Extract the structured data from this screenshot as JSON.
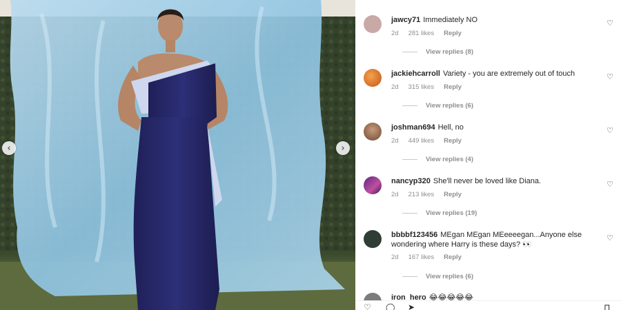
{
  "media": {
    "prev_icon": "‹",
    "next_icon": "›"
  },
  "comments": [
    {
      "username": "jawcy71",
      "text": "Immediately NO",
      "age": "2d",
      "likes": "281 likes",
      "reply": "Reply",
      "view_replies": "View replies (8)",
      "avatar_color": "#c9a9a6"
    },
    {
      "username": "jackiehcarroll",
      "text": "Variety - you are extremely out of touch",
      "age": "2d",
      "likes": "315 likes",
      "reply": "Reply",
      "view_replies": "View replies (6)",
      "avatar_color": "#d9772f"
    },
    {
      "username": "joshman694",
      "text": "Hell, no",
      "age": "2d",
      "likes": "449 likes",
      "reply": "Reply",
      "view_replies": "View replies (4)",
      "avatar_color": "#a67a5b"
    },
    {
      "username": "nancyp320",
      "text": "She'll never be loved like Diana.",
      "age": "2d",
      "likes": "213 likes",
      "reply": "Reply",
      "view_replies": "View replies (19)",
      "avatar_color": "#8a3fa0"
    },
    {
      "username": "bbbbf123456",
      "text": "MEgan MEgan MEeeeegan...Anyone else wondering where Harry is these days? 👀",
      "age": "2d",
      "likes": "167 likes",
      "reply": "Reply",
      "view_replies": "View replies (6)",
      "avatar_color": "#2f3d35"
    },
    {
      "username": "iron_hero",
      "text": "😂😂😂😂😂",
      "avatar_color": "#7c7c7c"
    }
  ],
  "icons": {
    "heart": "♡",
    "bottom": [
      "♡",
      "◯",
      "➤",
      "⊓"
    ]
  }
}
